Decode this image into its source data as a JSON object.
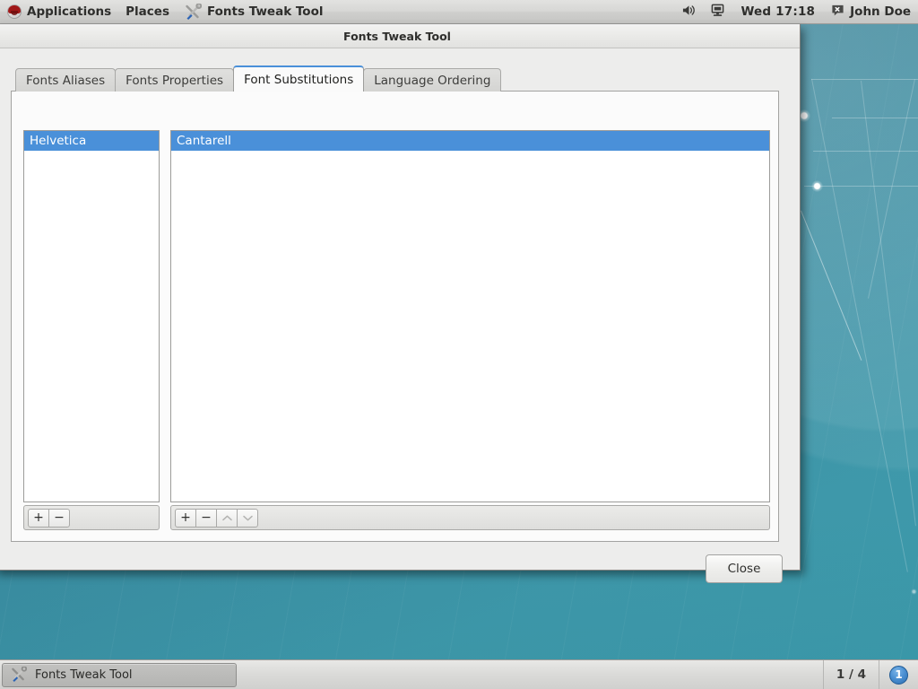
{
  "top_panel": {
    "applications_label": "Applications",
    "places_label": "Places",
    "active_app_label": "Fonts Tweak Tool",
    "active_app_icon": "tools-icon",
    "logo_icon": "fedora-logo-icon",
    "volume_icon": "volume-icon",
    "display_icon": "display-icon",
    "clock": "Wed 17:18",
    "user_name": "John Doe",
    "user_status_icon": "chat-offline-icon"
  },
  "window": {
    "title": "Fonts Tweak Tool",
    "tabs": [
      {
        "label": "Fonts Aliases",
        "active": false
      },
      {
        "label": "Fonts Properties",
        "active": false
      },
      {
        "label": "Font Substitutions",
        "active": true
      },
      {
        "label": "Language Ordering",
        "active": false
      }
    ],
    "left_pane": {
      "rows": [
        {
          "label": "Helvetica",
          "selected": true
        }
      ],
      "toolbar": [
        {
          "name": "add-button",
          "glyph": "+",
          "disabled": false
        },
        {
          "name": "remove-button",
          "glyph": "−",
          "disabled": false
        }
      ]
    },
    "right_pane": {
      "rows": [
        {
          "label": "Cantarell",
          "selected": true
        }
      ],
      "toolbar": [
        {
          "name": "add-button",
          "glyph": "+",
          "disabled": false
        },
        {
          "name": "remove-button",
          "glyph": "−",
          "disabled": false
        },
        {
          "name": "move-up-button",
          "glyph": "chevron-up-icon",
          "disabled": true
        },
        {
          "name": "move-down-button",
          "glyph": "chevron-down-icon",
          "disabled": true
        }
      ]
    },
    "close_label": "Close"
  },
  "taskbar": {
    "window_button_label": "Fonts Tweak Tool",
    "window_button_icon": "tools-icon",
    "workspace_count": "1 / 4",
    "current_workspace": "1"
  },
  "colors": {
    "selection_blue": "#4a90d9",
    "panel_gray": "#d7d7d5",
    "desktop_teal": "#3a93a8",
    "active_tab_accent": "#4a90d9"
  }
}
